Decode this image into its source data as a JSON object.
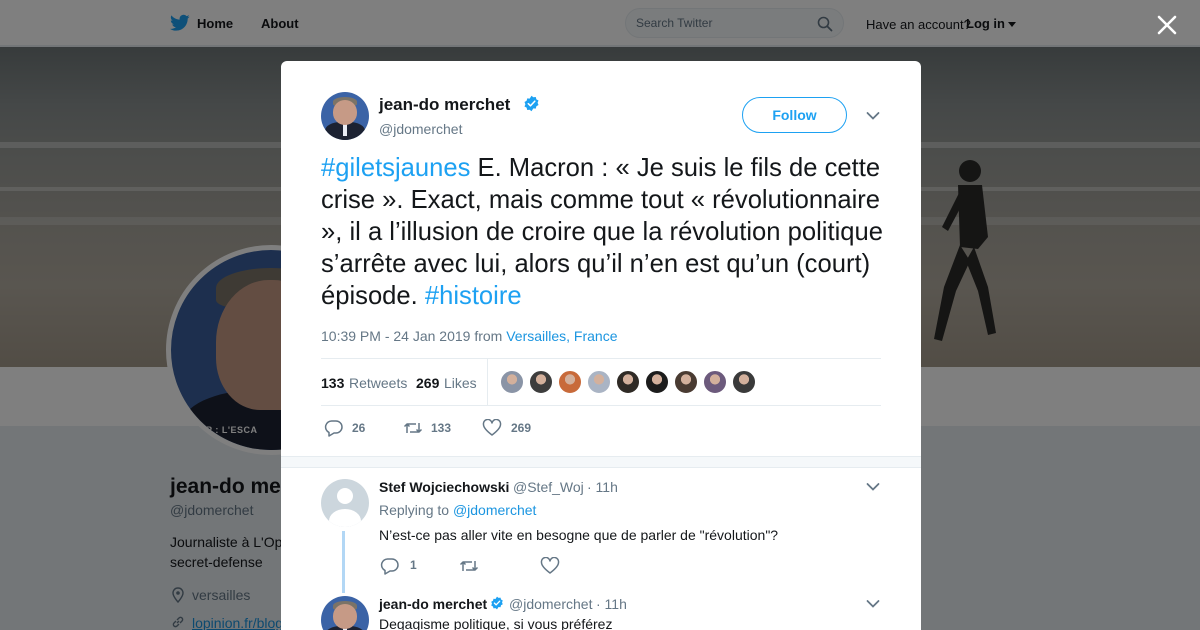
{
  "header": {
    "nav": {
      "home": "Home",
      "about": "About"
    },
    "search": {
      "placeholder": "Search Twitter"
    },
    "account_prompt": "Have an account?",
    "login": "Log in"
  },
  "profile_background": {
    "name": "jean-do me",
    "handle": "@jdomerchet",
    "bio_line1": "Journaliste à L'Op",
    "bio_line2": "secret-defense",
    "location": "versailles",
    "link": "lopinion.fr/blog",
    "avatar_caption": "UMP : L'ESCA"
  },
  "tweet": {
    "author_name": "jean-do merchet",
    "author_handle": "@jdomerchet",
    "follow_label": "Follow",
    "text": {
      "hashtag1": "#giletsjaunes",
      "body": " E. Macron : « Je suis le fils de cette crise ». Exact, mais comme tout « révolutionnaire », il a l’illusion de croire que la révolution politique s’arrête avec lui, alors qu’il n’en est qu’un (court) épisode. ",
      "hashtag2": "#histoire"
    },
    "timestamp": "10:39 PM - 24 Jan 2019",
    "from": "from",
    "place": "Versailles, France",
    "retweets_count": "133",
    "retweets_label": "Retweets",
    "likes_count": "269",
    "likes_label": "Likes",
    "likers_colors": [
      "#8a94a6",
      "#3d3d3d",
      "#c86a3a",
      "#aab4c4",
      "#2f2a25",
      "#1c1c1c",
      "#4a3b32",
      "#6c5a7c",
      "#3a3a3a"
    ],
    "actions": {
      "replies": "26",
      "retweets": "133",
      "likes": "269"
    }
  },
  "replies": [
    {
      "name": "Stef Wojciechowski",
      "handle": "@Stef_Woj",
      "time": "· 11h",
      "replying_label": "Replying to",
      "replying_to": "@jdomerchet",
      "text": "N’est-ce pas aller vite en besogne que de parler de \"révolution\"?",
      "replies": "1"
    },
    {
      "name": "jean-do merchet",
      "handle": "@jdomerchet",
      "time": "· 11h",
      "text": "Degagisme politique, si vous préférez"
    }
  ],
  "colors": {
    "accent": "#1da1f2",
    "link": "#1b95e0",
    "thread": "#b2d7f5"
  }
}
